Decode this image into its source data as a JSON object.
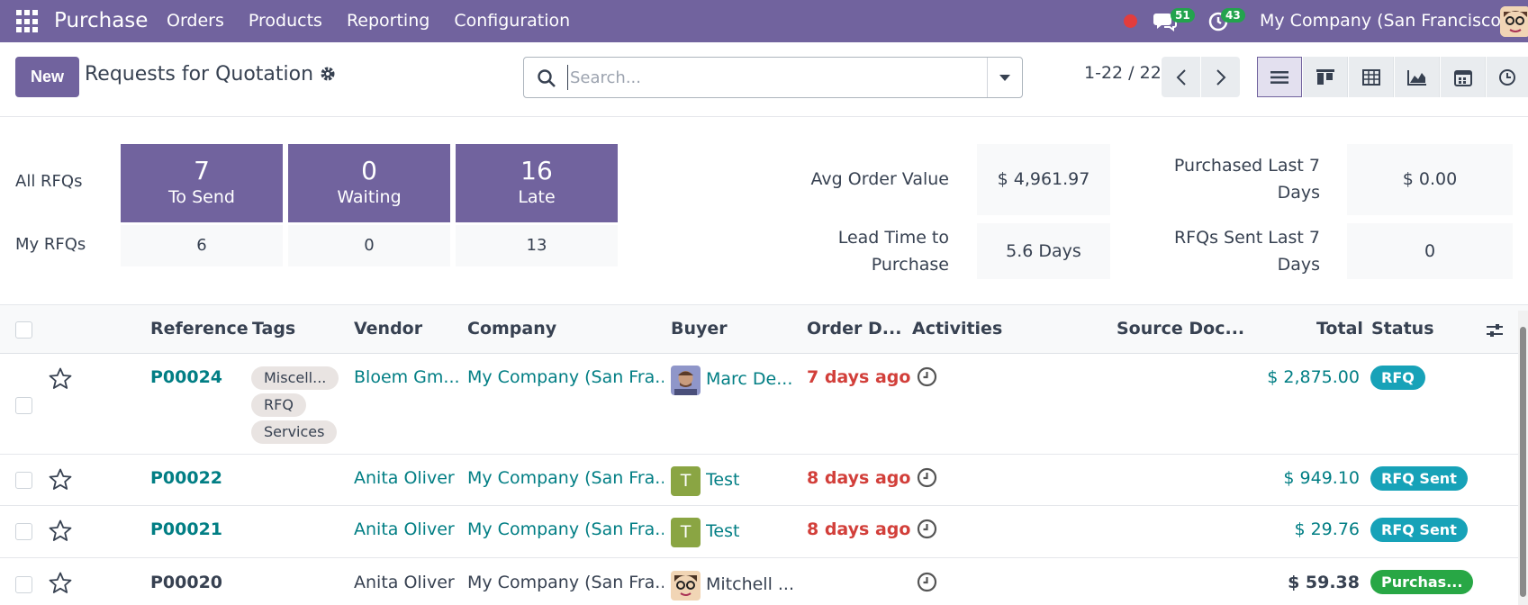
{
  "navbar": {
    "app_name": "Purchase",
    "menu": [
      "Orders",
      "Products",
      "Reporting",
      "Configuration"
    ],
    "chat_count": "51",
    "activity_count": "43",
    "company": "My Company (San Francisco)",
    "brand_color": "#71639e"
  },
  "control": {
    "new_label": "New",
    "title": "Requests for Quotation",
    "search_placeholder": "Search...",
    "pager": "1-22 / 22"
  },
  "dashboard": {
    "row_all_label": "All RFQs",
    "row_my_label": "My RFQs",
    "tiles": [
      {
        "value": "7",
        "label": "To Send",
        "my": "6"
      },
      {
        "value": "0",
        "label": "Waiting",
        "my": "0"
      },
      {
        "value": "16",
        "label": "Late",
        "my": "13"
      }
    ],
    "kpis": {
      "avg_order_label": "Avg Order Value",
      "avg_order_value": "$ 4,961.97",
      "purchased_label_1": "Purchased Last 7",
      "purchased_label_2": "Days",
      "purchased_value": "$ 0.00",
      "lead_label_1": "Lead Time to",
      "lead_label_2": "Purchase",
      "lead_value": "5.6 Days",
      "sent_label_1": "RFQs Sent Last 7",
      "sent_label_2": "Days",
      "sent_value": "0"
    }
  },
  "table": {
    "columns": {
      "reference": "Reference",
      "tags": "Tags",
      "vendor": "Vendor",
      "company": "Company",
      "buyer": "Buyer",
      "order_date": "Order D...",
      "activities": "Activities",
      "source": "Source Doc...",
      "total": "Total",
      "status": "Status"
    },
    "rows": [
      {
        "ref": "P00024",
        "tags": [
          "Miscell...",
          "RFQ",
          "Services"
        ],
        "vendor": "Bloem Gm...",
        "company": "My Company (San Fra...",
        "buyer": "Marc De...",
        "date": "7 days ago",
        "total": "$ 2,875.00",
        "status": "RFQ"
      },
      {
        "ref": "P00022",
        "tags": [],
        "vendor": "Anita Oliver",
        "company": "My Company (San Fra...",
        "buyer": "Test",
        "buyer_initial": "T",
        "date": "8 days ago",
        "total": "$ 949.10",
        "status": "RFQ Sent"
      },
      {
        "ref": "P00021",
        "tags": [],
        "vendor": "Anita Oliver",
        "company": "My Company (San Fra...",
        "buyer": "Test",
        "buyer_initial": "T",
        "date": "8 days ago",
        "total": "$ 29.76",
        "status": "RFQ Sent"
      },
      {
        "ref": "P00020",
        "tags": [],
        "vendor": "Anita Oliver",
        "company": "My Company (San Fra...",
        "buyer": "Mitchell ...",
        "date": "",
        "total": "$ 59.38",
        "status": "Purchas..."
      }
    ]
  }
}
